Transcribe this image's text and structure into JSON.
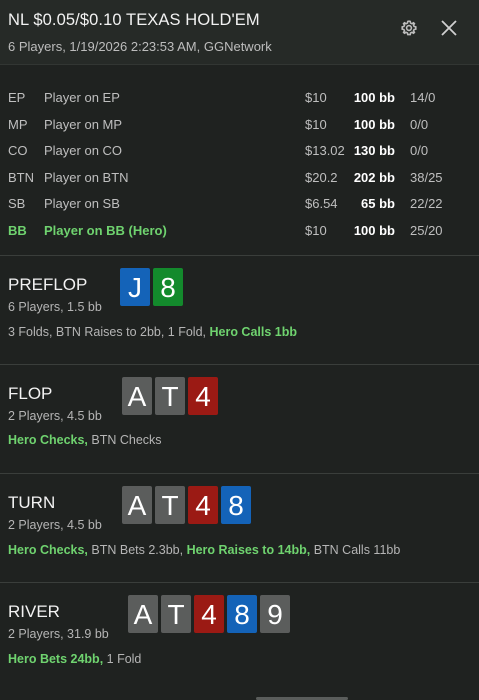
{
  "header": {
    "title": "NL $0.05/$0.10 TEXAS HOLD'EM",
    "subtitle": "6 Players, 1/19/2026 2:23:53 AM, GGNetwork",
    "settings_icon": "gear-icon",
    "close_icon": "close-icon"
  },
  "players": [
    {
      "pos": "EP",
      "name": "Player on EP",
      "money": "$10",
      "bb": "100 bb",
      "stat": "14/0"
    },
    {
      "pos": "MP",
      "name": "Player on MP",
      "money": "$10",
      "bb": "100 bb",
      "stat": "0/0"
    },
    {
      "pos": "CO",
      "name": "Player on CO",
      "money": "$13.02",
      "bb": "130 bb",
      "stat": "0/0"
    },
    {
      "pos": "BTN",
      "name": "Player on BTN",
      "money": "$20.2",
      "bb": "202 bb",
      "stat": "38/25"
    },
    {
      "pos": "SB",
      "name": "Player on SB",
      "money": "$6.54",
      "bb": "65 bb",
      "stat": "22/22"
    },
    {
      "pos": "BB",
      "name": "Player on BB (Hero)",
      "money": "$10",
      "bb": "100 bb",
      "stat": "25/20"
    }
  ],
  "streets": {
    "preflop": {
      "name": "PREFLOP",
      "info": "6 Players, 1.5 bb",
      "cards": [
        "J",
        "8"
      ],
      "actions": [
        "3 Folds, BTN Raises to 2bb, 1 Fold, ",
        "Hero Calls 1bb"
      ]
    },
    "flop": {
      "name": "FLOP",
      "info": "2 Players, 4.5 bb",
      "cards": [
        "A",
        "T",
        "4"
      ],
      "actions": [
        "Hero Checks,",
        " BTN Checks"
      ]
    },
    "turn": {
      "name": "TURN",
      "info": "2 Players, 4.5 bb",
      "cards": [
        "A",
        "T",
        "4",
        "8"
      ],
      "actions": [
        "Hero Checks,",
        " BTN Bets 2.3bb, ",
        "Hero Raises to 14bb,",
        " BTN Calls 11bb"
      ]
    },
    "river": {
      "name": "RIVER",
      "info": "2 Players, 31.9 bb",
      "cards": [
        "A",
        "T",
        "4",
        "8",
        "9"
      ],
      "actions": [
        "Hero Bets 24bb,",
        " 1 Fold"
      ]
    }
  },
  "colors": {
    "hero": "#6fd36f",
    "card_grey": "#5b5d5c",
    "card_red": "#9b1a14",
    "card_blue": "#1463b8",
    "card_green": "#138a2c",
    "background": "#1f2220"
  }
}
